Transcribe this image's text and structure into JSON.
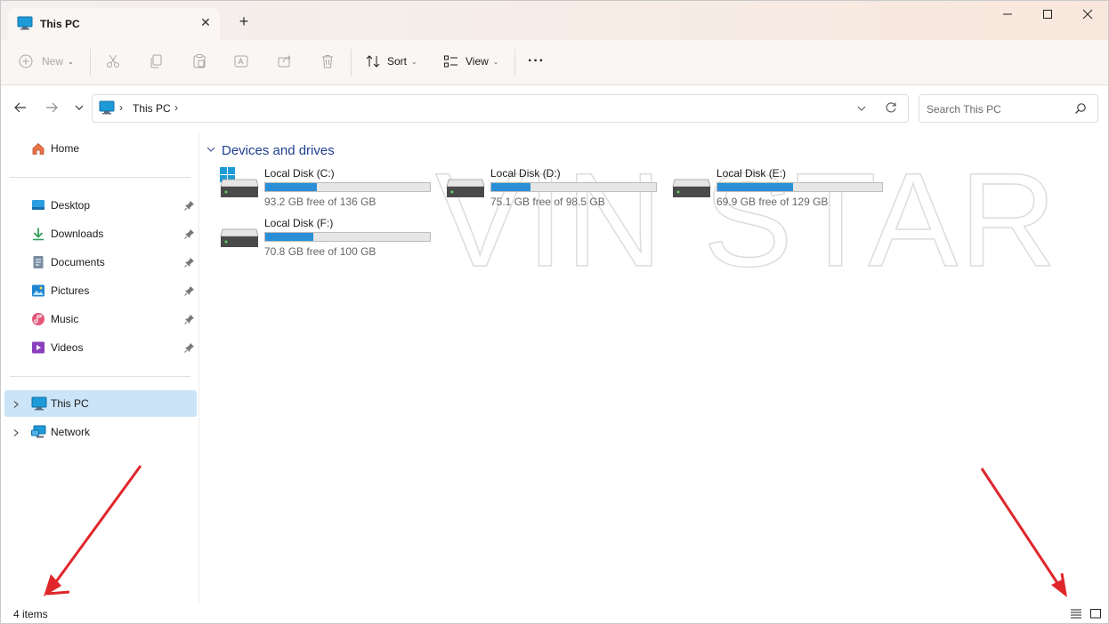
{
  "window": {
    "tab_title": "This PC",
    "close_tab": "✕",
    "new_tab": "+"
  },
  "toolbar": {
    "new_label": "New",
    "sort_label": "Sort",
    "view_label": "View",
    "more_label": "···"
  },
  "address": {
    "breadcrumb": "This PC",
    "search_placeholder": "Search This PC"
  },
  "sidebar": {
    "home": "Home",
    "quick_access": [
      {
        "label": "Desktop",
        "icon": "desktop-icon"
      },
      {
        "label": "Downloads",
        "icon": "download-icon"
      },
      {
        "label": "Documents",
        "icon": "documents-icon"
      },
      {
        "label": "Pictures",
        "icon": "pictures-icon"
      },
      {
        "label": "Music",
        "icon": "music-icon"
      },
      {
        "label": "Videos",
        "icon": "videos-icon"
      }
    ],
    "this_pc": "This PC",
    "network": "Network"
  },
  "content": {
    "group_title": "Devices and drives",
    "drives": [
      {
        "name": "Local Disk (C:)",
        "free": "93.2 GB free of 136 GB",
        "used_fraction": 0.315
      },
      {
        "name": "Local Disk (D:)",
        "free": "75.1 GB free of 98.5 GB",
        "used_fraction": 0.238
      },
      {
        "name": "Local Disk (E:)",
        "free": "69.9 GB free of 129 GB",
        "used_fraction": 0.458
      },
      {
        "name": "Local Disk (F:)",
        "free": "70.8 GB free of 100 GB",
        "used_fraction": 0.292
      }
    ]
  },
  "status": {
    "item_count": "4 items"
  },
  "watermark": "VIN STAR",
  "colors": {
    "accent": "#2a8fd6",
    "selection": "#cce4f7",
    "group_header": "#1f3f8f",
    "annotation_arrow": "#e0262b"
  }
}
